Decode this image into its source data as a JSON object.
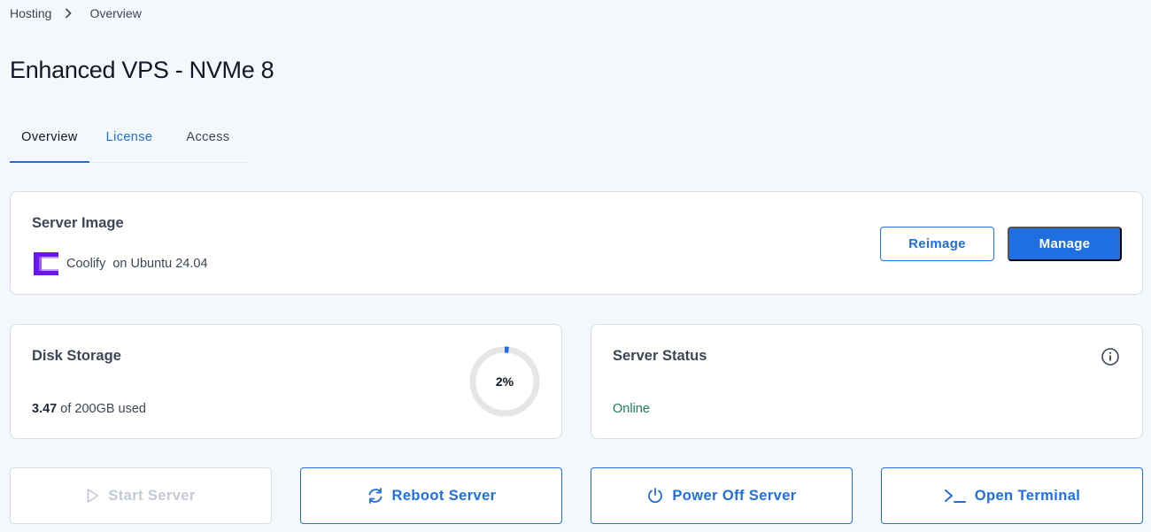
{
  "breadcrumb": {
    "items": [
      "Hosting",
      "Overview"
    ]
  },
  "page": {
    "title": "Enhanced VPS - NVMe 8"
  },
  "tabs": [
    {
      "label": "Overview",
      "active": true
    },
    {
      "label": "License",
      "active": false
    },
    {
      "label": "Access",
      "active": false
    }
  ],
  "server_image": {
    "title": "Server Image",
    "app_name": "Coolify",
    "os_text": "on Ubuntu 24.04",
    "reimage_label": "Reimage",
    "manage_label": "Manage",
    "logo_icon": "coolify-logo",
    "logo_color": "#6b16ed"
  },
  "disk": {
    "title": "Disk Storage",
    "used_value": "3.47",
    "total_text": "of 200GB used",
    "percent_label": "2%",
    "percent": 0.02
  },
  "status": {
    "title": "Server Status",
    "value": "Online",
    "value_color": "#1e7e5a",
    "info_icon": "info-icon"
  },
  "actions": {
    "start": {
      "label": "Start Server",
      "icon": "play-icon",
      "disabled": true
    },
    "reboot": {
      "label": "Reboot Server",
      "icon": "refresh-icon",
      "disabled": false
    },
    "power_off": {
      "label": "Power Off Server",
      "icon": "power-icon",
      "disabled": false
    },
    "terminal": {
      "label": "Open Terminal",
      "icon": "terminal-icon",
      "disabled": false
    }
  },
  "colors": {
    "accent": "#1f6fe0",
    "background": "#f4f7fb"
  }
}
